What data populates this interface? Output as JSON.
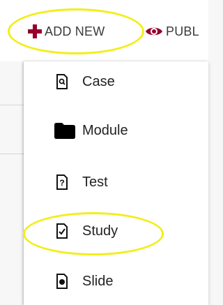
{
  "toolbar": {
    "add_new_label": "ADD NEW",
    "publish_label": "PUBL",
    "add_icon": "plus-icon",
    "publish_icon": "eye-icon"
  },
  "menu": {
    "items": [
      {
        "label": "Case",
        "icon": "document-search-icon"
      },
      {
        "label": "Module",
        "icon": "folder-icon"
      },
      {
        "label": "Test",
        "icon": "question-file-icon"
      },
      {
        "label": "Study",
        "icon": "checkmark-file-icon"
      },
      {
        "label": "Slide",
        "icon": "dot-file-icon"
      }
    ]
  },
  "colors": {
    "accent": "#96002d",
    "highlight": "#f2ee1a",
    "text": "#3a3a3a"
  }
}
